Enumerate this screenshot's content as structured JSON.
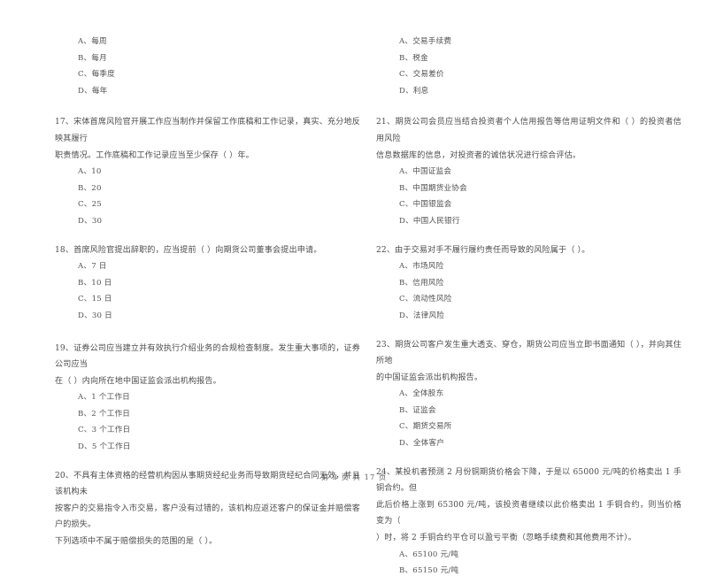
{
  "document": {
    "type": "exam-paper",
    "language": "zh-CN",
    "footer": "第 3 页  共 17 页"
  },
  "left_column": {
    "continued_options": [
      "A、每周",
      "B、每月",
      "C、每季度",
      "D、每年"
    ],
    "questions": [
      {
        "number": "17",
        "stem_lines": [
          "17、宋体首席风险官开展工作应当制作并保留工作底稿和工作记录，真实、充分地反映其履行",
          "职责情况。工作底稿和工作记录应当至少保存（    ）年。"
        ],
        "options": [
          "A、10",
          "B、20",
          "C、25",
          "D、30"
        ]
      },
      {
        "number": "18",
        "stem_lines": [
          "18、首席风险官提出辞职的，应当提前（    ）向期货公司董事会提出申请。"
        ],
        "options": [
          "A、7 日",
          "B、10 日",
          "C、15 日",
          "D、30 日"
        ]
      },
      {
        "number": "19",
        "stem_lines": [
          "19、证券公司应当建立并有效执行介绍业务的合规检查制度。发生重大事项的，证券公司应当",
          "在（    ）内向所在地中国证监会派出机构报告。"
        ],
        "options": [
          "A、1 个工作日",
          "B、2 个工作日",
          "C、3 个工作日",
          "D、5 个工作日"
        ]
      },
      {
        "number": "20",
        "stem_lines": [
          "20、不具有主体资格的经营机构因从事期货经纪业务而导致期货经纪合同无效，并且该机构未",
          "按客户的交易指令入市交易，客户没有过错的，该机构应返还客户的保证金并赔偿客户的损失。",
          "下列选项中不属于赔偿损失的范围的是（    ）。"
        ],
        "options": []
      }
    ]
  },
  "right_column": {
    "continued_options": [
      "A、交易手续费",
      "B、税金",
      "C、交易差价",
      "D、利息"
    ],
    "questions": [
      {
        "number": "21",
        "stem_lines": [
          "21、期货公司会员应当结合投资者个人信用报告等信用证明文件和（    ）的投资者信用风险",
          "信息数据库的信息，对投资者的诚信状况进行综合评估。"
        ],
        "options": [
          "A、中国证监会",
          "B、中国期货业协会",
          "C、中国银监会",
          "D、中国人民银行"
        ]
      },
      {
        "number": "22",
        "stem_lines": [
          "22、由于交易对手不履行履约责任而导致的风险属于（    ）。"
        ],
        "options": [
          "A、市场风险",
          "B、信用风险",
          "C、流动性风险",
          "D、法律风险"
        ]
      },
      {
        "number": "23",
        "stem_lines": [
          "23、期货公司客户发生重大透支、穿仓，期货公司应当立即书面通知（    ），并向其住所地",
          "的中国证监会派出机构报告。"
        ],
        "options": [
          "A、全体股东",
          "B、证监会",
          "C、期货交易所",
          "D、全体客户"
        ]
      },
      {
        "number": "24",
        "stem_lines": [
          "24、某投机者预测 2 月份铜期货价格会下降，于是以 65000 元/吨的价格卖出 1 手铜合约。但",
          "此后价格上涨到 65300 元/吨，该投资者继续以此价格卖出 1 手铜合约，则当价格变为（",
          "）时，将 2 手铜合约平仓可以盈亏平衡（忽略手续费和其他费用不计）。"
        ],
        "options": [
          "A、65100 元/吨",
          "B、65150 元/吨"
        ]
      }
    ]
  }
}
